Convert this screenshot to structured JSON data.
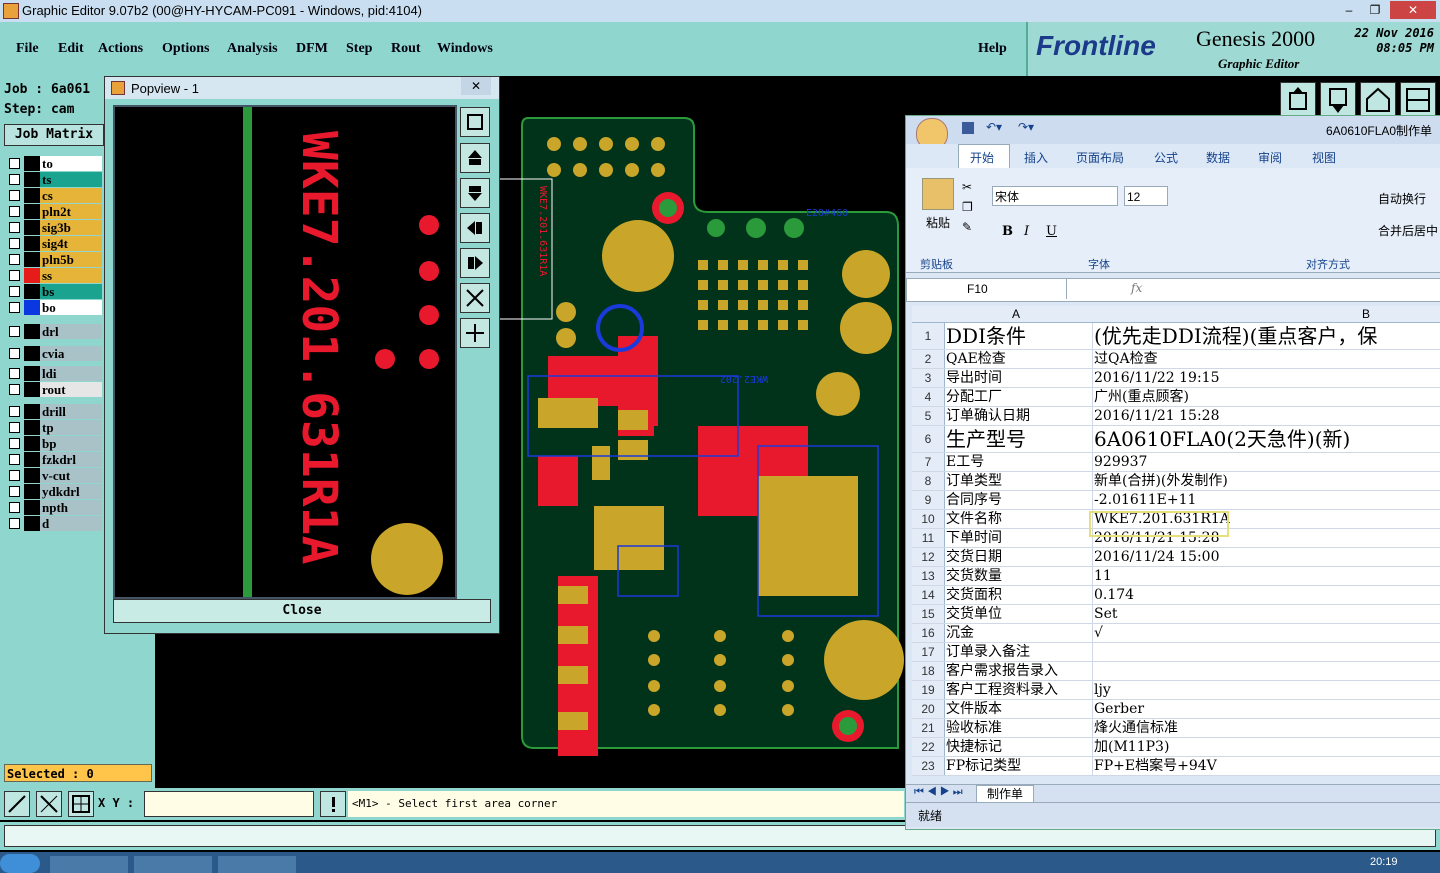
{
  "titlebar": {
    "title": "Graphic Editor 9.07b2 (00@HY-HYCAM-PC091 - Windows, pid:4104)",
    "minimize": "–",
    "restore": "❐",
    "close": "✕"
  },
  "menu": [
    "File",
    "Edit",
    "Actions",
    "Options",
    "Analysis",
    "DFM",
    "Step",
    "Rout",
    "Windows"
  ],
  "help": "Help",
  "logo": {
    "brand": "Frontline",
    "product": "Genesis 2000",
    "editor": "Graphic Editor",
    "date": "22 Nov 2016",
    "time": "08:05 PM"
  },
  "job": {
    "job_line": "Job : 6a061",
    "step_line": "Step: cam",
    "matrix_button": "Job Matrix"
  },
  "layers": [
    {
      "name": "to",
      "color": "#000000",
      "bg": "#ffffff"
    },
    {
      "name": "ts",
      "color": "#000000",
      "bg": "#1aa38f"
    },
    {
      "name": "cs",
      "color": "#000000",
      "bg": "#e7b43a"
    },
    {
      "name": "pln2t",
      "color": "#000000",
      "bg": "#e7b43a"
    },
    {
      "name": "sig3b",
      "color": "#000000",
      "bg": "#e7b43a"
    },
    {
      "name": "sig4t",
      "color": "#000000",
      "bg": "#e7b43a"
    },
    {
      "name": "pln5b",
      "color": "#000000",
      "bg": "#e7b43a"
    },
    {
      "name": "ss",
      "color": "#e81b1b",
      "bg": "#e7b43a"
    },
    {
      "name": "bs",
      "color": "#000000",
      "bg": "#1aa38f"
    },
    {
      "name": "bo",
      "color": "#0a37e0",
      "bg": "#ffffff"
    },
    {
      "name": "drl",
      "color": "#000000",
      "bg": "#a8c2c8"
    },
    {
      "name": "cvia",
      "color": "#000000",
      "bg": "#a8c2c8"
    },
    {
      "name": "ldi",
      "color": "#000000",
      "bg": "#a8c2c8"
    },
    {
      "name": "rout",
      "color": "#000000",
      "bg": "#e6e6e6"
    },
    {
      "name": "drill",
      "color": "#000000",
      "bg": "#a8c2c8"
    },
    {
      "name": "tp",
      "color": "#000000",
      "bg": "#a8c2c8"
    },
    {
      "name": "bp",
      "color": "#000000",
      "bg": "#a8c2c8"
    },
    {
      "name": "fzkdrl",
      "color": "#000000",
      "bg": "#a8c2c8"
    },
    {
      "name": "v-cut",
      "color": "#000000",
      "bg": "#a8c2c8"
    },
    {
      "name": "ydkdrl",
      "color": "#000000",
      "bg": "#a8c2c8"
    },
    {
      "name": "npth",
      "color": "#000000",
      "bg": "#a8c2c8"
    },
    {
      "name": "d",
      "color": "#000000",
      "bg": "#a8c2c8"
    }
  ],
  "selected": "Selected : 0",
  "xy_label": "X Y :",
  "xy_value": "",
  "prompt": "<M1> - Select first area corner",
  "popview": {
    "title": "Popview - 1",
    "close_x": "✕",
    "text": "WKE7.201.631R1A",
    "close_button": "Close"
  },
  "pcb": {
    "silk1": "WKE7.201.631R1A",
    "silk2": "WKE2.202",
    "silk3": "E20#460"
  },
  "excel": {
    "window_title": "6A0610FLA0制作单",
    "tabs": [
      "开始",
      "插入",
      "页面布局",
      "公式",
      "数据",
      "审阅",
      "视图"
    ],
    "paste": "粘贴",
    "clipboard": "剪贴板",
    "font_name": "宋体",
    "font_size": "12",
    "font_group": "字体",
    "align_group": "对齐方式",
    "wrap": "自动换行",
    "merge": "合并后居中",
    "namebox": "F10",
    "fx": "fx",
    "col_a": "A",
    "col_b": "B",
    "rows": [
      {
        "n": "1",
        "a": "DDI条件",
        "b": "(优先走DDI流程)(重点客户，保",
        "big": true
      },
      {
        "n": "2",
        "a": "QAE检查",
        "b": "过QA检查"
      },
      {
        "n": "3",
        "a": "导出时间",
        "b": "2016/11/22 19:15"
      },
      {
        "n": "4",
        "a": "分配工厂",
        "b": "广州(重点顾客)"
      },
      {
        "n": "5",
        "a": "订单确认日期",
        "b": "2016/11/21 15:28"
      },
      {
        "n": "6",
        "a": "生产型号",
        "b": "6A0610FLA0(2天急件)(新)",
        "big": true
      },
      {
        "n": "7",
        "a": "E工号",
        "b": "929937"
      },
      {
        "n": "8",
        "a": "订单类型",
        "b": "新单(合拼)(外发制作)"
      },
      {
        "n": "9",
        "a": "合同序号",
        "b": "-2.01611E+11"
      },
      {
        "n": "10",
        "a": "文件名称",
        "b": "WKE7.201.631R1A"
      },
      {
        "n": "11",
        "a": "下单时间",
        "b": "2016/11/21 15:28"
      },
      {
        "n": "12",
        "a": "交货日期",
        "b": "2016/11/24 15:00"
      },
      {
        "n": "13",
        "a": "交货数量",
        "b": "11"
      },
      {
        "n": "14",
        "a": "交货面积",
        "b": "0.174"
      },
      {
        "n": "15",
        "a": "交货单位",
        "b": "Set"
      },
      {
        "n": "16",
        "a": "沉金",
        "b": "√"
      },
      {
        "n": "17",
        "a": "订单录入备注",
        "b": ""
      },
      {
        "n": "18",
        "a": "客户需求报告录入",
        "b": ""
      },
      {
        "n": "19",
        "a": "客户工程资料录入",
        "b": "ljy"
      },
      {
        "n": "20",
        "a": "文件版本",
        "b": "Gerber"
      },
      {
        "n": "21",
        "a": "验收标准",
        "b": "烽火通信标准"
      },
      {
        "n": "22",
        "a": "快捷标记",
        "b": "加(M11P3)"
      },
      {
        "n": "23",
        "a": "FP标记类型",
        "b": "FP+E档案号+94V"
      }
    ],
    "sheet_tab": "制作单",
    "status": "就绪"
  },
  "taskbar": {
    "clock": "20:19"
  }
}
